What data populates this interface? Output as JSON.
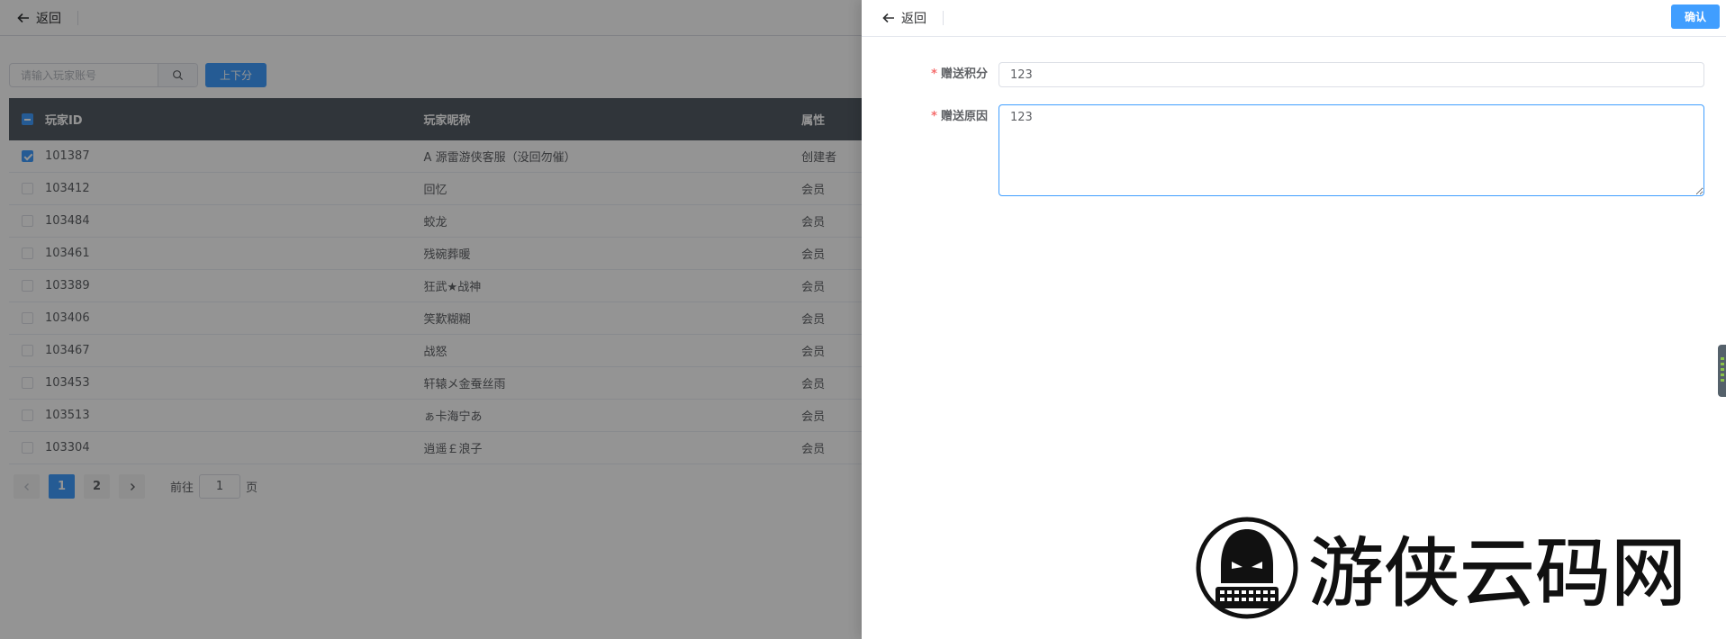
{
  "page": {
    "back_label": "返回",
    "search": {
      "placeholder": "请输入玩家账号"
    },
    "adjust_button": "上下分",
    "table": {
      "headers": {
        "id": "玩家ID",
        "nickname": "玩家昵称",
        "attr": "属性"
      },
      "rows": [
        {
          "id": "101387",
          "nickname": "A 源雷游侠客服（没回勿催）",
          "attr": "创建者",
          "checked": true
        },
        {
          "id": "103412",
          "nickname": "回忆",
          "attr": "会员",
          "checked": false
        },
        {
          "id": "103484",
          "nickname": "蛟龙",
          "attr": "会员",
          "checked": false
        },
        {
          "id": "103461",
          "nickname": "残碗葬暖",
          "attr": "会员",
          "checked": false
        },
        {
          "id": "103389",
          "nickname": "狂武★战神",
          "attr": "会员",
          "checked": false
        },
        {
          "id": "103406",
          "nickname": "笑歎糊糊",
          "attr": "会员",
          "checked": false
        },
        {
          "id": "103467",
          "nickname": "战怒",
          "attr": "会员",
          "checked": false
        },
        {
          "id": "103453",
          "nickname": "轩辕メ金蚕丝雨",
          "attr": "会员",
          "checked": false
        },
        {
          "id": "103513",
          "nickname": "ぁ卡海宁あ",
          "attr": "会员",
          "checked": false
        },
        {
          "id": "103304",
          "nickname": "逍遥￡浪子",
          "attr": "会员",
          "checked": false
        }
      ]
    },
    "pagination": {
      "pages": [
        "1",
        "2"
      ],
      "current": "1",
      "goto_prefix": "前往",
      "goto_value": "1",
      "goto_suffix": "页"
    }
  },
  "drawer": {
    "back_label": "返回",
    "confirm_label": "确认",
    "fields": {
      "points": {
        "label": "赠送积分",
        "value": "123"
      },
      "reason": {
        "label": "赠送原因",
        "value": "123"
      }
    }
  },
  "watermark": {
    "text": "游侠云码网"
  },
  "colors": {
    "primary": "#409eff",
    "header_bg": "#545c64",
    "required": "#f56c6c",
    "logo_red": "#e8262b"
  }
}
